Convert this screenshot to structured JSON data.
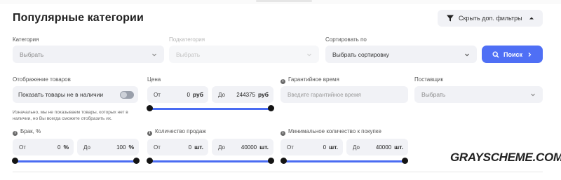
{
  "title": "Популярные категории",
  "filters_button": {
    "label": "Скрыть доп. фильтры",
    "icon": "filter-icon"
  },
  "category": {
    "label": "Категория",
    "value": "Выбрать"
  },
  "subcategory": {
    "label": "Подкатегория",
    "value": "Выбрать"
  },
  "sort": {
    "label": "Сортировать по",
    "value": "Выбрать сортировку"
  },
  "search_button": {
    "label": "Поиск"
  },
  "display": {
    "label": "Отображение товаров",
    "toggle_label": "Показать товары не в наличии",
    "toggle_on": false,
    "hint": "Изначально, мы не показываем товары, которых нет в наличии, но Вы всегда сможете отобразить их."
  },
  "price": {
    "label": "Цена",
    "from_label": "От",
    "from_value": "0",
    "to_label": "До",
    "to_value": "244375",
    "unit": "руб"
  },
  "warranty": {
    "label": "Гарантийное время",
    "placeholder": "Введите гарантийное время"
  },
  "supplier": {
    "label": "Поставщик",
    "value": "Выбрать"
  },
  "defect": {
    "label": "Брак, %",
    "from_label": "От",
    "from_value": "0",
    "to_label": "До",
    "to_value": "100",
    "unit": "%"
  },
  "sales": {
    "label": "Количество продаж",
    "from_label": "От",
    "from_value": "0",
    "to_label": "До",
    "to_value": "40000",
    "unit": "шт."
  },
  "min_purchase": {
    "label": "Минимальное количество к покупке",
    "from_label": "От",
    "from_value": "0",
    "to_label": "До",
    "to_value": "40000",
    "unit": "шт."
  },
  "watermark": "GRAYSCHEME.COM",
  "colors": {
    "accent": "#4f6ff5",
    "slider": "#4a6cf2",
    "field_bg": "#f1f2f6"
  }
}
